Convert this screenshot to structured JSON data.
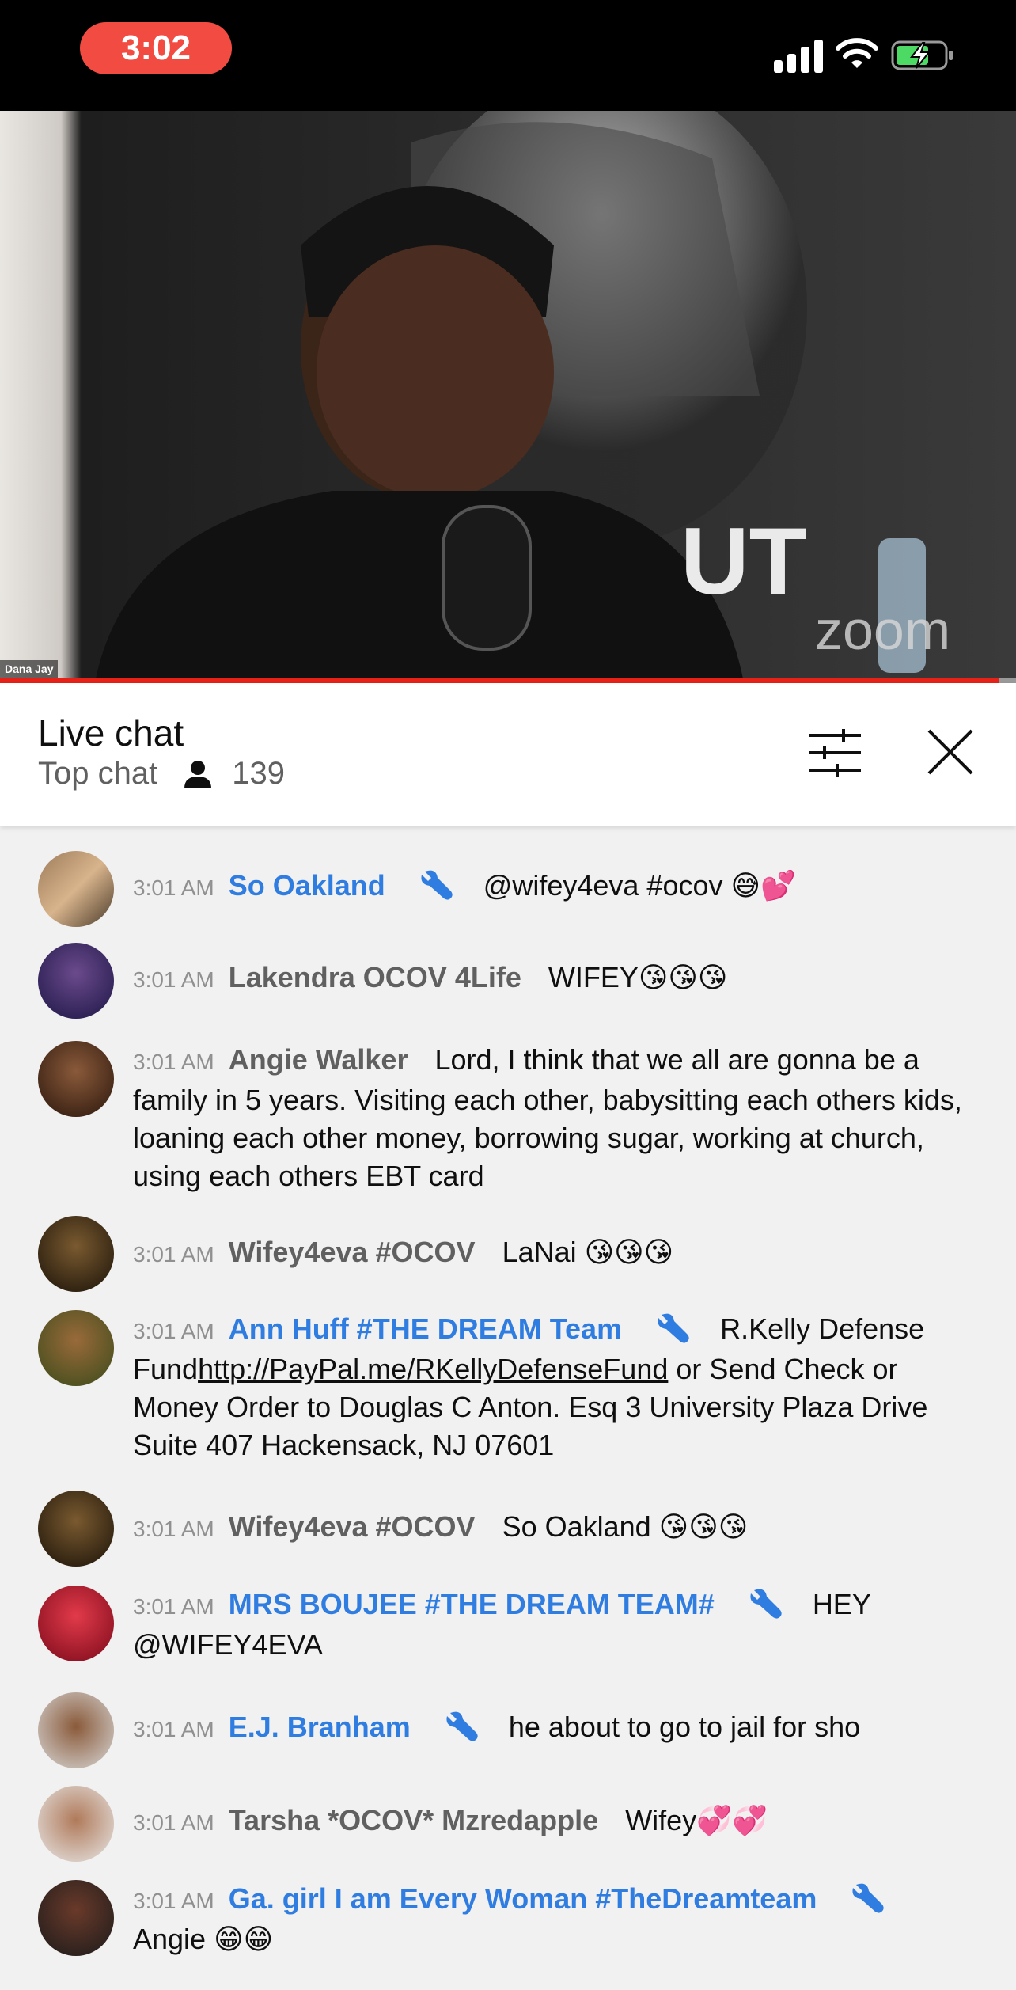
{
  "status_bar": {
    "time": "3:02"
  },
  "video": {
    "participant_name": "Dana Jay"
  },
  "chat_header": {
    "title": "Live chat",
    "mode": "Top chat",
    "viewer_count": "139"
  },
  "colors": {
    "moderator_name": "#2f7de1",
    "progress": "#e62117",
    "time_pill": "#f24b42"
  },
  "messages": [
    {
      "time": "3:01 AM",
      "author": "So Oakland",
      "moderator": true,
      "text": "@wifey4eva #ocov 😅💕"
    },
    {
      "time": "3:01 AM",
      "author": "Lakendra OCOV 4Life",
      "moderator": false,
      "text": "WIFEY😘😘😘"
    },
    {
      "time": "3:01 AM",
      "author": "Angie Walker",
      "moderator": false,
      "text": "Lord, I think that we all are gonna be a family in 5 years. Visiting each other, babysitting each others kids, loaning each other money, borrowing sugar, working at church, using each others EBT card"
    },
    {
      "time": "3:01 AM",
      "author": "Wifey4eva #OCOV",
      "moderator": false,
      "text": "LaNai 😘😘😘"
    },
    {
      "time": "3:01 AM",
      "author": "Ann Huff #THE DREAM Team",
      "moderator": true,
      "text_before": "R.Kelly Defense Fund",
      "link": "http://PayPal.me/RKellyDefenseFund",
      "text_after": " or Send Check or Money Order to Douglas C Anton. Esq 3 University Plaza Drive Suite 407 Hackensack, NJ 07601"
    },
    {
      "time": "3:01 AM",
      "author": "Wifey4eva #OCOV",
      "moderator": false,
      "text": "So Oakland 😘😘😘"
    },
    {
      "time": "3:01 AM",
      "author": "MRS BOUJEE #THE DREAM TEAM#",
      "moderator": true,
      "text": "HEY @WIFEY4EVA"
    },
    {
      "time": "3:01 AM",
      "author": "E.J. Branham",
      "moderator": true,
      "text": "he about to go to jail for sho"
    },
    {
      "time": "3:01 AM",
      "author": "Tarsha *OCOV* Mzredapple",
      "moderator": false,
      "text": "Wifey💞💞"
    },
    {
      "time": "3:01 AM",
      "author": "Ga. girl I am Every Woman #TheDreamteam",
      "moderator": true,
      "text": "Angie 😁😁"
    }
  ]
}
